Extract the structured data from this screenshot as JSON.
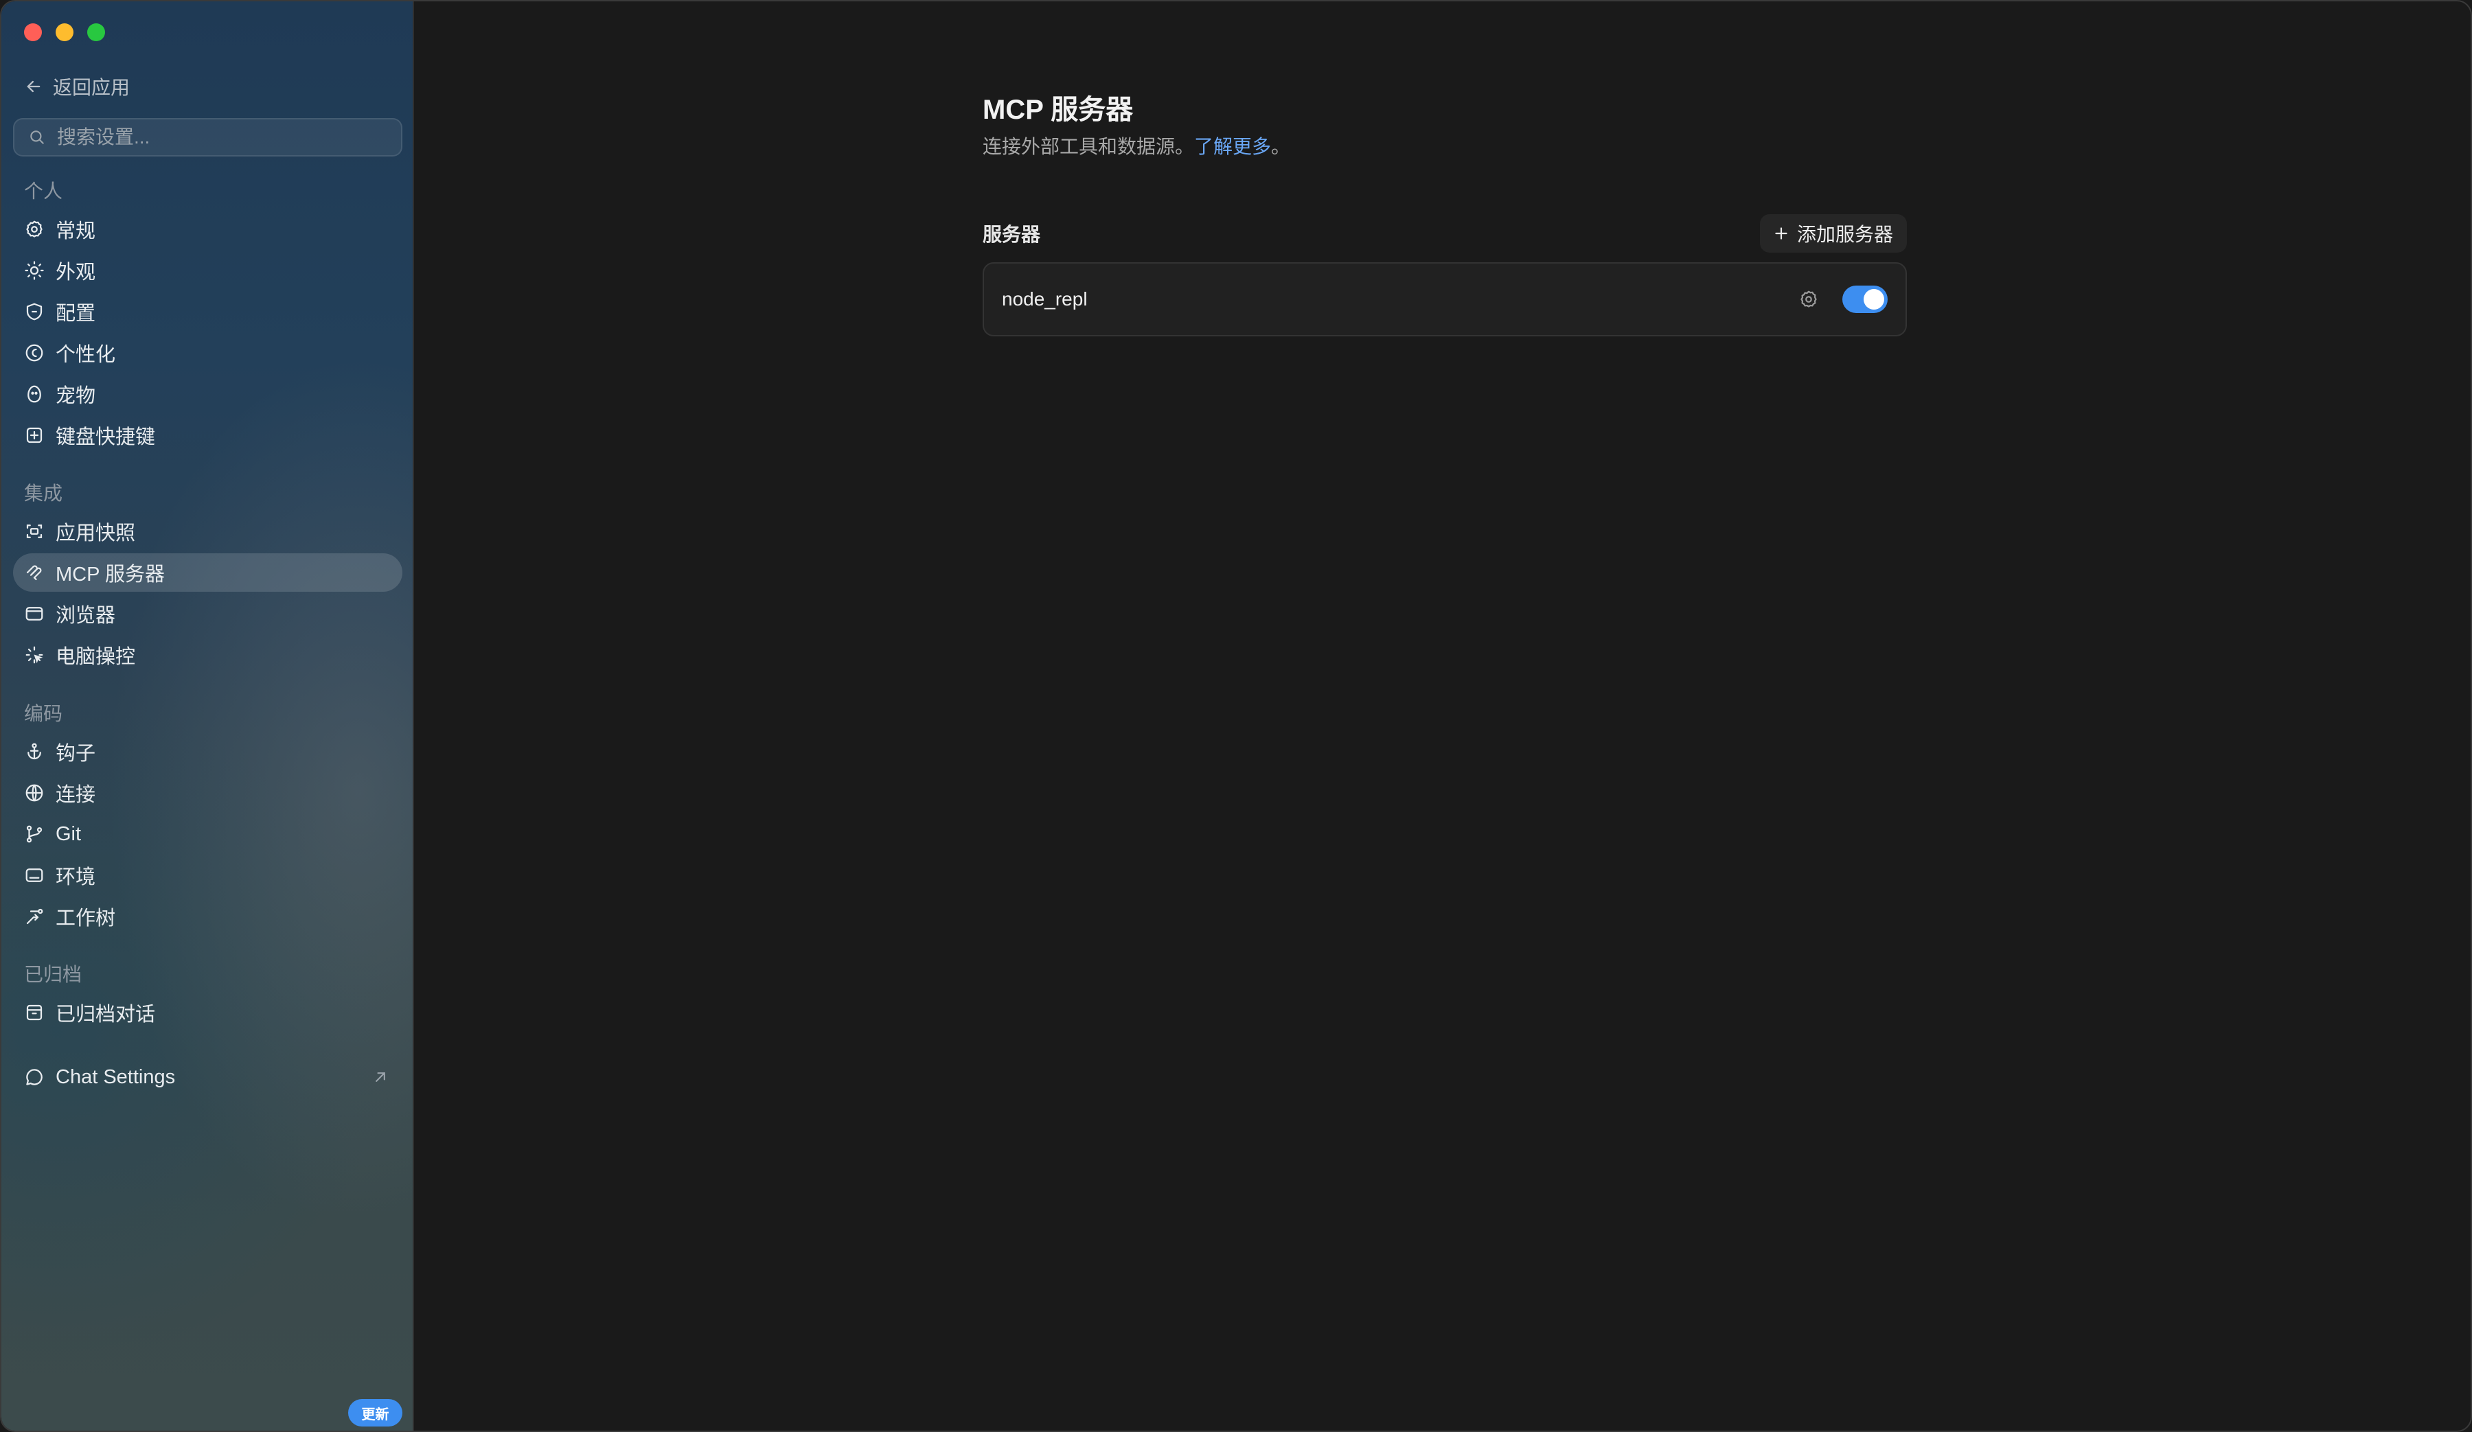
{
  "window": {
    "controls": [
      "close",
      "minimize",
      "zoom"
    ]
  },
  "sidebar": {
    "back_label": "返回应用",
    "search_placeholder": "搜索设置...",
    "sections": [
      {
        "label": "个人",
        "items": [
          {
            "label": "常规",
            "icon": "gear-icon"
          },
          {
            "label": "外观",
            "icon": "sun-icon"
          },
          {
            "label": "配置",
            "icon": "shield-icon"
          },
          {
            "label": "个性化",
            "icon": "persona-icon"
          },
          {
            "label": "宠物",
            "icon": "pet-icon"
          },
          {
            "label": "键盘快捷键",
            "icon": "keyboard-shortcut-icon"
          }
        ]
      },
      {
        "label": "集成",
        "items": [
          {
            "label": "应用快照",
            "icon": "snapshot-icon"
          },
          {
            "label": "MCP 服务器",
            "icon": "mcp-icon",
            "active": true
          },
          {
            "label": "浏览器",
            "icon": "browser-icon"
          },
          {
            "label": "电脑操控",
            "icon": "computer-control-icon"
          }
        ]
      },
      {
        "label": "编码",
        "items": [
          {
            "label": "钩子",
            "icon": "anchor-icon"
          },
          {
            "label": "连接",
            "icon": "globe-icon"
          },
          {
            "label": "Git",
            "icon": "git-branch-icon"
          },
          {
            "label": "环境",
            "icon": "terminal-icon"
          },
          {
            "label": "工作树",
            "icon": "worktree-icon"
          }
        ]
      },
      {
        "label": "已归档",
        "items": [
          {
            "label": "已归档对话",
            "icon": "archive-icon"
          }
        ]
      }
    ],
    "chat_settings": {
      "label": "Chat Settings",
      "icon": "chat-bubble-icon",
      "external": true
    },
    "update_badge": "更新"
  },
  "main": {
    "title": "MCP 服务器",
    "subtitle": "连接外部工具和数据源。",
    "learn_more": "了解更多",
    "subtitle_end": "。",
    "servers_label": "服务器",
    "add_button": "添加服务器",
    "servers": [
      {
        "name": "node_repl",
        "enabled": true
      }
    ]
  },
  "colors": {
    "accent": "#3d8ef0",
    "link": "#6aa7f5",
    "background": "#1a1a1a",
    "card": "#212121"
  }
}
